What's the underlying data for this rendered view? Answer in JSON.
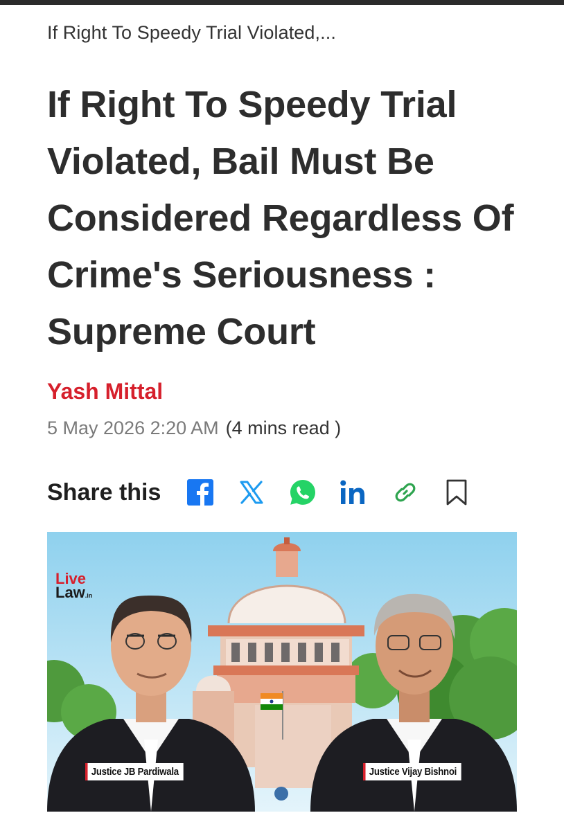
{
  "article": {
    "breadcrumb": "If Right To Speedy Trial Violated,...",
    "headline": "If Right To Speedy Trial Violated, Bail Must Be Considered Regardless Of Crime's Seriousness : Supreme Court",
    "author": "Yash Mittal",
    "date": "5 May 2026 2:20 AM",
    "read_time": "(4 mins read )"
  },
  "share": {
    "label": "Share this",
    "buttons": [
      {
        "icon": "facebook-icon",
        "color": "#1877f2"
      },
      {
        "icon": "x-icon",
        "color": "#1d9bf0"
      },
      {
        "icon": "whatsapp-icon",
        "color": "#25d366"
      },
      {
        "icon": "linkedin-icon",
        "color": "#0a66c2"
      },
      {
        "icon": "link-icon",
        "color": "#2ea44f"
      },
      {
        "icon": "bookmark-icon",
        "color": "#333333"
      }
    ]
  },
  "hero_image": {
    "logo_line1": "Live",
    "logo_line2": "Law",
    "logo_suffix": ".in",
    "caption_left": "Justice JB Pardiwala",
    "caption_right": "Justice Vijay Bishnoi"
  },
  "colors": {
    "accent": "#d6202c",
    "text": "#2d2d2d",
    "muted": "#7a7a7a"
  }
}
